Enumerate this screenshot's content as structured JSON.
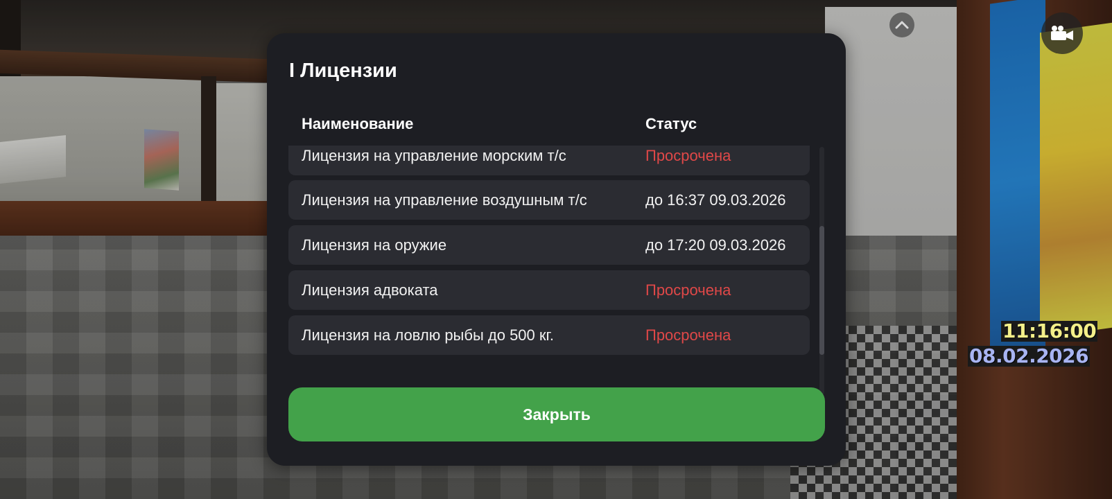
{
  "hud": {
    "clock_time": "11:16:00",
    "clock_date": "08.02.2026",
    "collapse_icon": "chevron-up-icon",
    "camera_icon": "video-camera-icon"
  },
  "modal": {
    "title": "I Лицензии",
    "columns": {
      "name": "Наименование",
      "status": "Статус"
    },
    "rows": [
      {
        "name": "Лицензия на управление морским т/с",
        "status": "Просрочена",
        "expired": true
      },
      {
        "name": "Лицензия на управление воздушным т/с",
        "status": "до 16:37 09.03.2026",
        "expired": false
      },
      {
        "name": "Лицензия на оружие",
        "status": "до 17:20 09.03.2026",
        "expired": false
      },
      {
        "name": "Лицензия адвоката",
        "status": "Просрочена",
        "expired": true
      },
      {
        "name": "Лицензия на ловлю рыбы до 500 кг.",
        "status": "Просрочена",
        "expired": true
      }
    ],
    "scroll_position": 0.66,
    "close_label": "Закрыть"
  },
  "colors": {
    "expired_status": "#e04848",
    "close_button": "#43a24a",
    "panel": "#1d1e23",
    "row": "#2b2c32"
  }
}
